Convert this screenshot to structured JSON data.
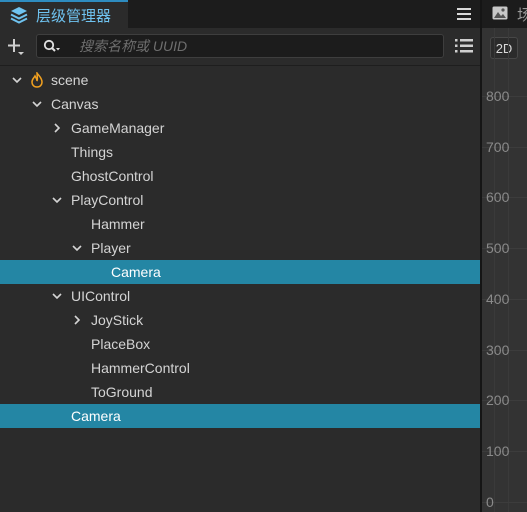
{
  "hierarchy_panel": {
    "title": "层级管理器",
    "search_placeholder": "搜索名称或 UUID",
    "tree": [
      {
        "label": "scene",
        "depth": 0,
        "arrow": "expanded",
        "icon": "scene-flame-icon",
        "selected": false
      },
      {
        "label": "Canvas",
        "depth": 1,
        "arrow": "expanded",
        "selected": false
      },
      {
        "label": "GameManager",
        "depth": 2,
        "arrow": "collapsed",
        "selected": false
      },
      {
        "label": "Things",
        "depth": 2,
        "arrow": "none",
        "selected": false
      },
      {
        "label": "GhostControl",
        "depth": 2,
        "arrow": "none",
        "selected": false
      },
      {
        "label": "PlayControl",
        "depth": 2,
        "arrow": "expanded",
        "selected": false
      },
      {
        "label": "Hammer",
        "depth": 3,
        "arrow": "none",
        "selected": false
      },
      {
        "label": "Player",
        "depth": 3,
        "arrow": "expanded",
        "selected": false
      },
      {
        "label": "Camera",
        "depth": 4,
        "arrow": "none",
        "selected": true
      },
      {
        "label": "UIControl",
        "depth": 2,
        "arrow": "expanded",
        "selected": false
      },
      {
        "label": "JoyStick",
        "depth": 3,
        "arrow": "collapsed",
        "selected": false
      },
      {
        "label": "PlaceBox",
        "depth": 3,
        "arrow": "none",
        "selected": false
      },
      {
        "label": "HammerControl",
        "depth": 3,
        "arrow": "none",
        "selected": false
      },
      {
        "label": "ToGround",
        "depth": 3,
        "arrow": "none",
        "selected": false
      },
      {
        "label": "Camera",
        "depth": 2,
        "arrow": "none",
        "selected": true
      }
    ]
  },
  "scene_panel": {
    "tab_label": "场",
    "mode_button": "2D",
    "ruler_labels": [
      "800",
      "700",
      "600",
      "500",
      "400",
      "300",
      "200",
      "100",
      "0"
    ]
  },
  "colors": {
    "accent": "#2e8cc0",
    "selection": "#2486a4",
    "panel_bg": "#2b2b2b",
    "header_bg": "#1c1c1c",
    "scene_flame": "#f0a020"
  }
}
